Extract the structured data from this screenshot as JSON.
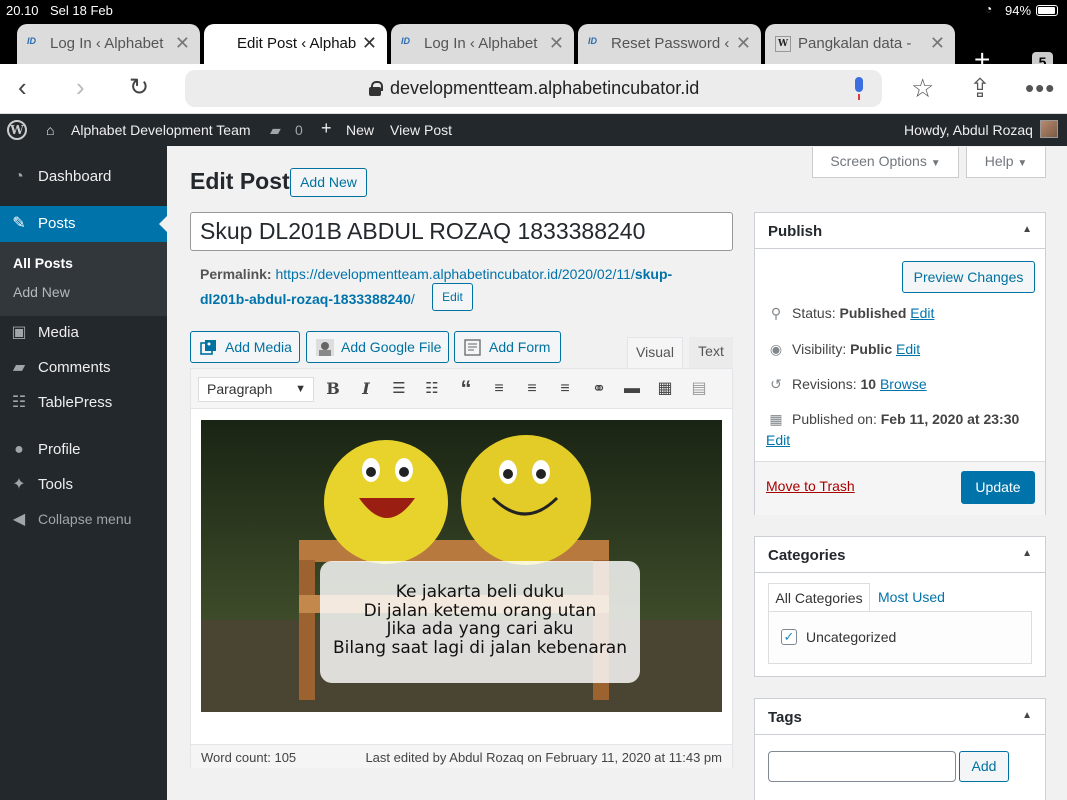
{
  "status_bar": {
    "time": "20.10",
    "date": "Sel 18 Feb",
    "battery": "94%"
  },
  "browser": {
    "tabs": [
      {
        "title": "Log In ‹ Alphabet",
        "favicon": "alphabet-favicon",
        "active": false
      },
      {
        "title": "Edit Post ‹ Alphab",
        "favicon": "alphabet-favicon",
        "active": true
      },
      {
        "title": "Log In ‹ Alphabet",
        "favicon": "alphabet-favicon",
        "active": false
      },
      {
        "title": "Reset Password ‹",
        "favicon": "alphabet-favicon",
        "active": false
      },
      {
        "title": "Pangkalan data -",
        "favicon": "wikipedia-favicon",
        "active": false
      }
    ],
    "new_tab_glyph": "+",
    "tab_count": "5",
    "url": "developmentteam.alphabetincubator.id"
  },
  "admin_bar": {
    "site_name": "Alphabet Development Team",
    "comments_count": "0",
    "new_label": "New",
    "view_post_label": "View Post",
    "greeting": "Howdy, Abdul Rozaq"
  },
  "admin_menu": {
    "items": [
      {
        "label": "Dashboard",
        "icon": "dashboard-icon"
      },
      {
        "label": "Posts",
        "icon": "pin-icon",
        "current": true
      },
      {
        "label": "Media",
        "icon": "media-icon"
      },
      {
        "label": "Comments",
        "icon": "comment-icon"
      },
      {
        "label": "TablePress",
        "icon": "table-icon"
      },
      {
        "label": "Profile",
        "icon": "user-icon"
      },
      {
        "label": "Tools",
        "icon": "wrench-icon"
      },
      {
        "label": "Collapse menu",
        "icon": "collapse-icon"
      }
    ],
    "submenu": [
      {
        "label": "All Posts",
        "current": true
      },
      {
        "label": "Add New"
      }
    ]
  },
  "header": {
    "title": "Edit Post",
    "add_new_label": "Add New",
    "screen_options_label": "Screen Options",
    "help_label": "Help"
  },
  "post": {
    "title": "Skup DL201B ABDUL ROZAQ 1833388240",
    "permalink_label": "Permalink:",
    "permalink_base": "https://developmentteam.alphabetincubator.id/2020/02/11/",
    "permalink_slug": "skup-dl201b-abdul-rozaq-1833388240",
    "permalink_end": "/",
    "permalink_edit_label": "Edit"
  },
  "editor": {
    "media_buttons": [
      {
        "label": "Add Media",
        "icon": "add-media-icon"
      },
      {
        "label": "Add Google File",
        "icon": "google-file-icon"
      },
      {
        "label": "Add Form",
        "icon": "form-icon"
      }
    ],
    "tab_visual": "Visual",
    "tab_text": "Text",
    "format_value": "Paragraph",
    "image_caption_lines": [
      "Ke jakarta beli duku",
      "Di jalan ketemu orang utan",
      "Jika ada yang cari aku",
      "Bilang saat lagi di jalan kebenaran"
    ],
    "word_count": "Word count: 105",
    "last_edited": "Last edited by Abdul Rozaq on February 11, 2020 at 11:43 pm"
  },
  "publish_box": {
    "title": "Publish",
    "preview_label": "Preview Changes",
    "status_label": "Status:",
    "status_value": "Published",
    "status_edit": "Edit",
    "visibility_label": "Visibility:",
    "visibility_value": "Public",
    "visibility_edit": "Edit",
    "revisions_label": "Revisions:",
    "revisions_value": "10",
    "revisions_link": "Browse",
    "published_label": "Published on:",
    "published_value": "Feb 11, 2020 at 23:30",
    "published_edit": "Edit",
    "trash_label": "Move to Trash",
    "update_label": "Update"
  },
  "categories_box": {
    "title": "Categories",
    "tab_all": "All Categories",
    "tab_used": "Most Used",
    "items": [
      {
        "label": "Uncategorized",
        "checked": true
      }
    ]
  },
  "tags_box": {
    "title": "Tags",
    "add_label": "Add"
  },
  "colors": {
    "wp_blue": "#0073aa",
    "admin_dark": "#23282d",
    "trash_red": "#a00"
  }
}
